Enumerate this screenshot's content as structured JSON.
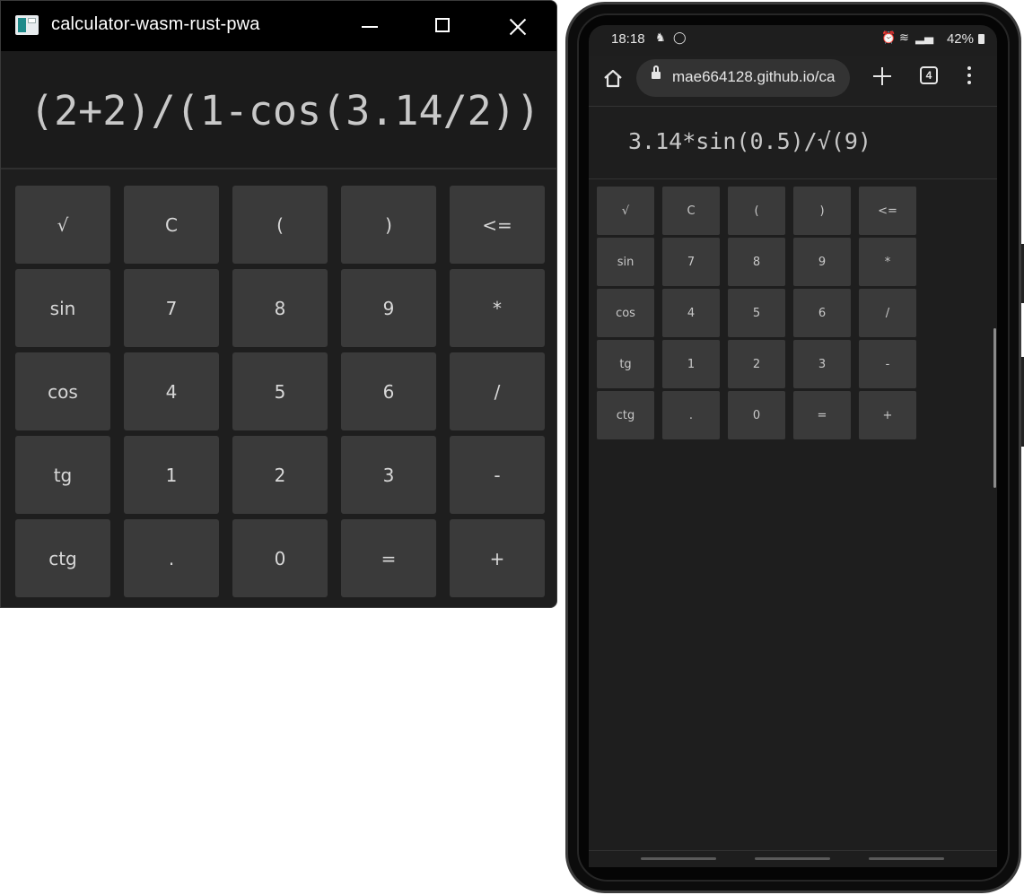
{
  "desktop": {
    "title": "calculator-wasm-rust-pwa",
    "expression": "(2+2)/(1-cos(3.14/2))",
    "keys": [
      "√",
      "C",
      "(",
      ")",
      "<=",
      "sin",
      "7",
      "8",
      "9",
      "*",
      "cos",
      "4",
      "5",
      "6",
      "/",
      "tg",
      "1",
      "2",
      "3",
      "-",
      "ctg",
      ".",
      "0",
      "=",
      "+"
    ]
  },
  "mobile": {
    "status": {
      "time": "18:18",
      "battery": "42%",
      "icons": [
        "notification-icon",
        "shield-icon",
        "alarm-icon",
        "wifi-icon",
        "signal-icon",
        "battery-icon"
      ]
    },
    "browser": {
      "url": "mae664128.github.io/ca",
      "tab_count": "4"
    },
    "expression": "3.14*sin(0.5)/√(9)",
    "keys": [
      "√",
      "C",
      "(",
      ")",
      "<=",
      "sin",
      "7",
      "8",
      "9",
      "*",
      "cos",
      "4",
      "5",
      "6",
      "/",
      "tg",
      "1",
      "2",
      "3",
      "-",
      "ctg",
      ".",
      "0",
      "=",
      "+"
    ]
  },
  "colors": {
    "window_bg": "#1e1e1e",
    "titlebar": "#000000",
    "key_bg": "#3a3a3a",
    "text": "#c8c8c8"
  }
}
